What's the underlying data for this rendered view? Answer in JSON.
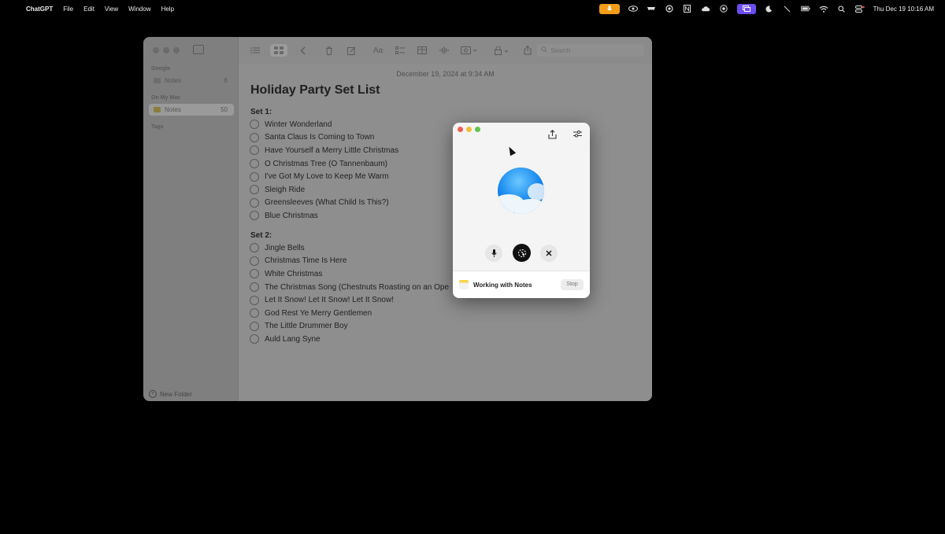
{
  "menubar": {
    "apple_glyph": "",
    "app_name": "ChatGPT",
    "menus": [
      "File",
      "Edit",
      "View",
      "Window",
      "Help"
    ],
    "status_icons": [
      "mic-recording-icon",
      "eye-icon",
      "mask-icon",
      "chatgpt-icon",
      "notion-icon",
      "cloud-icon",
      "target-icon",
      "screen-share-icon",
      "moon-icon",
      "slash-icon",
      "battery-icon",
      "wifi-icon",
      "search-icon",
      "control-center-icon"
    ],
    "clock": "Thu Dec 19  10:16 AM",
    "colors": {
      "mic_pill": "#f39c1a",
      "screen_pill": "#6c4df0"
    }
  },
  "notes": {
    "sidebar": {
      "section_google": "Google",
      "google_folder": {
        "label": "Notes",
        "count": "6"
      },
      "section_mac": "On My Mac",
      "mac_folder": {
        "label": "Notes",
        "count": "50"
      },
      "section_tags": "Tags",
      "new_folder": "New Folder"
    },
    "toolbar": {
      "search_placeholder": "Search"
    },
    "note": {
      "date": "December 19, 2024 at 9:34 AM",
      "title": "Holiday Party Set List",
      "set1_heading": "Set 1:",
      "set1": [
        "Winter Wonderland",
        "Santa Claus Is Coming to Town",
        "Have Yourself a Merry Little Christmas",
        "O Christmas Tree (O Tannenbaum)",
        "I've Got My Love to Keep Me Warm",
        "Sleigh Ride",
        "Greensleeves (What Child Is This?)",
        "Blue Christmas"
      ],
      "set2_heading": "Set 2:",
      "set2": [
        "Jingle Bells",
        "Christmas Time Is Here",
        "White Christmas",
        "The Christmas Song (Chestnuts Roasting on an Ope",
        "Let It Snow! Let It Snow! Let It Snow!",
        "God Rest Ye Merry Gentlemen",
        "The Little Drummer Boy",
        "Auld Lang Syne"
      ]
    }
  },
  "chatgpt_voice": {
    "task_label": "Working with Notes",
    "stop_label": "Stop",
    "orb_color": "#1e8ff0"
  }
}
